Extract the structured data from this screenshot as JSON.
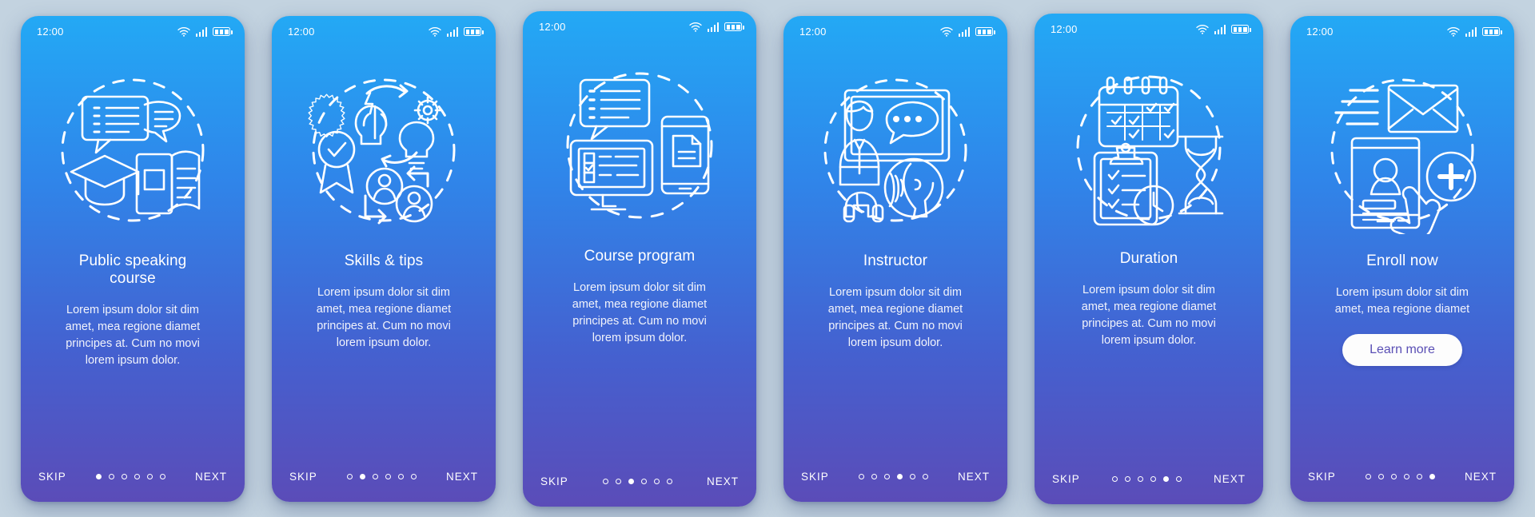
{
  "screens": [
    {
      "status": {
        "time": "12:00",
        "wifi_icon": "wifi-icon",
        "signal_icon": "signal-icon",
        "battery_icon": "battery-icon"
      },
      "illustration": "public-speaking-illustration",
      "title": "Public speaking\ncourse",
      "body": "Lorem ipsum dolor sit dim\namet, mea regione diamet\nprincipes at. Cum no movi\nlorem ipsum dolor.",
      "skip_label": "SKIP",
      "next_label": "NEXT",
      "dots_total": 6,
      "dot_active": 1
    },
    {
      "status": {
        "time": "12:00",
        "wifi_icon": "wifi-icon",
        "signal_icon": "signal-icon",
        "battery_icon": "battery-icon"
      },
      "illustration": "skills-tips-illustration",
      "title": "Skills & tips",
      "body": "Lorem ipsum dolor sit dim\namet, mea regione diamet\nprincipes at. Cum no movi\nlorem ipsum dolor.",
      "skip_label": "SKIP",
      "next_label": "NEXT",
      "dots_total": 6,
      "dot_active": 2
    },
    {
      "status": {
        "time": "12:00",
        "wifi_icon": "wifi-icon",
        "signal_icon": "signal-icon",
        "battery_icon": "battery-icon"
      },
      "illustration": "course-program-illustration",
      "title": "Course program",
      "body": "Lorem ipsum dolor sit dim\namet, mea regione diamet\nprincipes at. Cum no movi\nlorem ipsum dolor.",
      "skip_label": "SKIP",
      "next_label": "NEXT",
      "dots_total": 6,
      "dot_active": 3
    },
    {
      "status": {
        "time": "12:00",
        "wifi_icon": "wifi-icon",
        "signal_icon": "signal-icon",
        "battery_icon": "battery-icon"
      },
      "illustration": "instructor-illustration",
      "title": "Instructor",
      "body": "Lorem ipsum dolor sit dim\namet, mea regione diamet\nprincipes at. Cum no movi\nlorem ipsum dolor.",
      "skip_label": "SKIP",
      "next_label": "NEXT",
      "dots_total": 6,
      "dot_active": 4
    },
    {
      "status": {
        "time": "12:00",
        "wifi_icon": "wifi-icon",
        "signal_icon": "signal-icon",
        "battery_icon": "battery-icon"
      },
      "illustration": "duration-illustration",
      "title": "Duration",
      "body": "Lorem ipsum dolor sit dim\namet, mea regione diamet\nprincipes at. Cum no movi\nlorem ipsum dolor.",
      "skip_label": "SKIP",
      "next_label": "NEXT",
      "dots_total": 6,
      "dot_active": 5
    },
    {
      "status": {
        "time": "12:00",
        "wifi_icon": "wifi-icon",
        "signal_icon": "signal-icon",
        "battery_icon": "battery-icon"
      },
      "illustration": "enroll-now-illustration",
      "title": "Enroll now",
      "body": "Lorem ipsum dolor sit dim\namet, mea regione diamet",
      "cta_label": "Learn more",
      "skip_label": "SKIP",
      "next_label": "NEXT",
      "dots_total": 6,
      "dot_active": 6
    }
  ],
  "colors": {
    "page_background": "#c3d3e0",
    "gradient_top": "#23a9f5",
    "gradient_bottom": "#5b4cb8",
    "text": "#ffffff",
    "cta_background": "#fdfdfd",
    "cta_text": "#5a4fb5"
  }
}
